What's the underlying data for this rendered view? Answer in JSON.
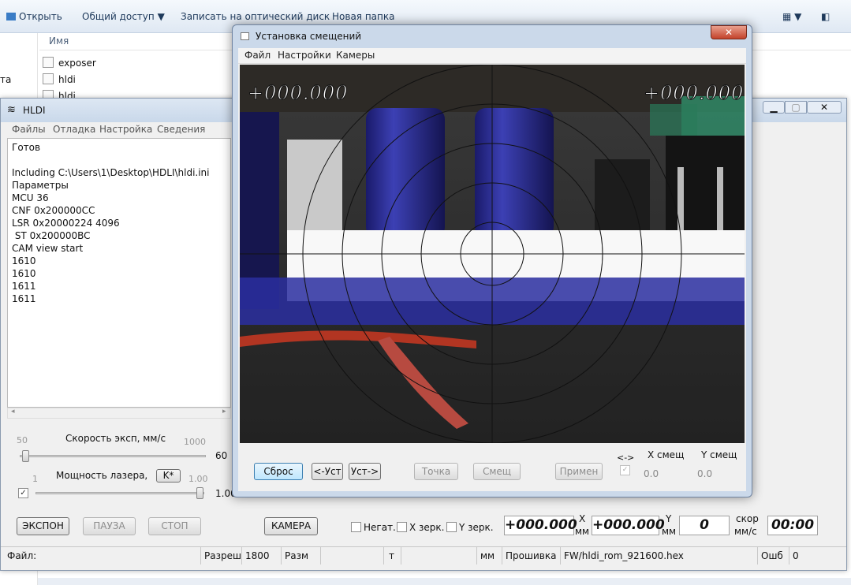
{
  "explorer": {
    "toolbar": {
      "open": "Открыть",
      "share": "Общий доступ",
      "burn": "Записать на оптический диск",
      "new_folder": "Новая папка"
    },
    "column_name": "Имя",
    "files": [
      "exposer",
      "hldi",
      "hldi"
    ],
    "side_fragment": "та"
  },
  "hldi": {
    "title": "HLDI",
    "menu": [
      "Файлы",
      "Отладка",
      "Настройка",
      "Сведения"
    ],
    "log": [
      "Готов",
      "",
      "Including C:\\Users\\1\\Desktop\\HDLI\\hldi.ini",
      "Параметры",
      "MCU 36",
      "CNF 0x200000CC",
      "LSR 0x20000224 4096",
      " ST 0x200000BC",
      "CAM view start",
      "1610",
      "1610",
      "1611",
      "1611"
    ],
    "speed": {
      "label": "Скорость эксп, мм/с",
      "min": "50",
      "max": "1000",
      "value": "60",
      "fraction": 0.01
    },
    "power": {
      "label": "Мощность лазера,",
      "k_button": "K*",
      "min": "1",
      "max": "1.00",
      "value": "1.00",
      "fraction": 1.0,
      "checked": true
    },
    "buttons": {
      "expose": "ЭКСПОН",
      "pause": "ПАУЗА",
      "stop": "СТОП",
      "camera": "КАМЕРА"
    },
    "checks": {
      "negative": "Негат.",
      "x_mirror": "X зерк.",
      "y_mirror": "Y зерк."
    },
    "x_value": "+000.000",
    "x_unit_top": "X",
    "x_unit_bottom": "мм",
    "y_value": "+000.000",
    "y_unit_top": "Y",
    "y_unit_bottom": "мм",
    "speed_value": "0",
    "speed_unit_top": "скор",
    "speed_unit_bottom": "мм/с",
    "time": "00:00",
    "status": {
      "file_label": "Файл:",
      "res_label": "Разреш",
      "res_value": "1800",
      "size_label": "Разм",
      "t_label": "т",
      "mm_label": "мм",
      "firmware_label": "Прошивка",
      "firmware_value": "FW/hldi_rom_921600.hex",
      "errors_label": "Ошб",
      "errors_value": "0"
    }
  },
  "dialog": {
    "title": "Установка смещений",
    "menu": [
      "Файл",
      "Настройки",
      "Камеры"
    ],
    "overlay_left": "+000.000",
    "overlay_right": "+000.000",
    "buttons": {
      "reset": "Сброс",
      "set_left": "<-Уст",
      "set_right": "Уст->",
      "point": "Точка",
      "offset": "Смещ",
      "apply": "Примен"
    },
    "swap_label": "<->",
    "x_offset_label": "X смещ",
    "y_offset_label": "Y смещ",
    "x_offset_value": "0.0",
    "y_offset_value": "0.0"
  }
}
